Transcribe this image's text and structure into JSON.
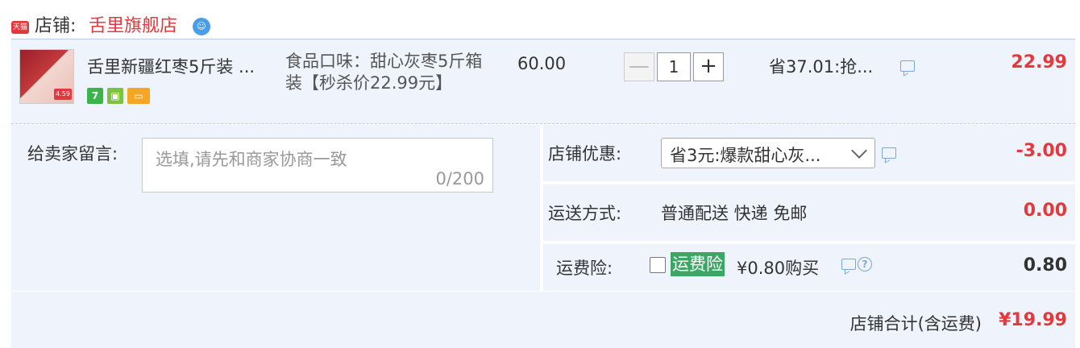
{
  "shop": {
    "badge": "天猫",
    "label": "店铺:",
    "name": "舌里旗舰店"
  },
  "item": {
    "thumb_tag": "4.59",
    "title": "舌里新疆红枣5斤装 ...",
    "service_icons": [
      "7-day-return-icon",
      "guarantee-icon",
      "credit-card-icon"
    ],
    "svc_7": "7",
    "sku": "食品口味：甜心灰枣5斤箱装【秒杀价22.99元】",
    "unit_price": "60.00",
    "quantity": "1",
    "qty_minus": "—",
    "qty_plus": "+",
    "promo": "省37.01:抢...",
    "total": "22.99"
  },
  "message": {
    "label": "给卖家留言:",
    "placeholder": "选填,请先和商家协商一致",
    "count": "0/200"
  },
  "discount": {
    "label": "店铺优惠:",
    "selected": "省3元:爆款甜心灰...",
    "amount": "-3.00"
  },
  "shipping": {
    "label": "运送方式:",
    "value": "普通配送 快递 免邮",
    "amount": "0.00"
  },
  "insurance": {
    "label": "运费险:",
    "badge": "运费险",
    "price": "¥0.80购买",
    "help": "?",
    "amount": "0.80"
  },
  "summary": {
    "label": "店铺合计(含运费)",
    "amount": "¥19.99"
  },
  "colors": {
    "accent_red": "#e4393c",
    "panel_bg": "#eef3fc",
    "insurance_green": "#3aa864"
  }
}
